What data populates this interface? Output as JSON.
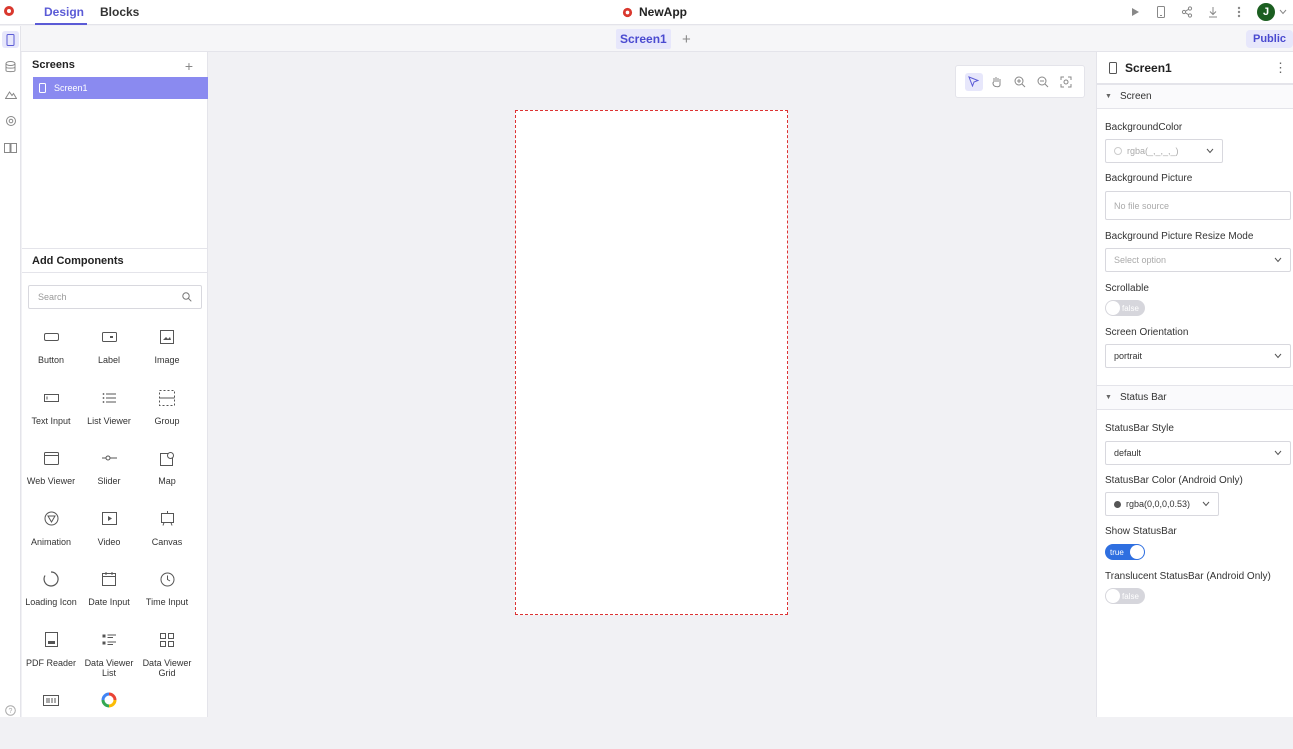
{
  "topbar": {
    "tabs": [
      "Design",
      "Blocks"
    ],
    "app_name": "NewApp",
    "avatar_initial": "J",
    "icons": [
      "play-icon",
      "device-icon",
      "share-icon",
      "download-icon",
      "more-vertical-icon",
      "chevron-down-icon"
    ]
  },
  "rail": {
    "items": [
      "phone-icon",
      "database-icon",
      "image-icon",
      "gear-icon",
      "book-icon",
      "help-icon"
    ]
  },
  "screenbar": {
    "active_screen": "Screen1",
    "add_symbol": "+",
    "public_label": "Public"
  },
  "screens_panel": {
    "title": "Screens",
    "add_symbol": "+",
    "items": [
      "Screen1"
    ]
  },
  "components_panel": {
    "title": "Add Components",
    "search_placeholder": "Search",
    "components": [
      {
        "label": "Button",
        "icon": "button-icon"
      },
      {
        "label": "Label",
        "icon": "label-icon"
      },
      {
        "label": "Image",
        "icon": "image-icon"
      },
      {
        "label": "Text Input",
        "icon": "text-input-icon"
      },
      {
        "label": "List Viewer",
        "icon": "list-icon"
      },
      {
        "label": "Group",
        "icon": "group-icon"
      },
      {
        "label": "Web Viewer",
        "icon": "web-viewer-icon"
      },
      {
        "label": "Slider",
        "icon": "slider-icon"
      },
      {
        "label": "Map",
        "icon": "map-icon"
      },
      {
        "label": "Animation",
        "icon": "animation-icon"
      },
      {
        "label": "Video",
        "icon": "video-icon"
      },
      {
        "label": "Canvas",
        "icon": "canvas-icon"
      },
      {
        "label": "Loading Icon",
        "icon": "loading-icon"
      },
      {
        "label": "Date Input",
        "icon": "calendar-icon"
      },
      {
        "label": "Time Input",
        "icon": "clock-icon"
      },
      {
        "label": "PDF Reader",
        "icon": "pdf-icon"
      },
      {
        "label": "Data Viewer List",
        "icon": "data-list-icon"
      },
      {
        "label": "Data Viewer Grid",
        "icon": "data-grid-icon"
      },
      {
        "label": "",
        "icon": "barcode-icon"
      },
      {
        "label": "",
        "icon": "google-icon"
      }
    ]
  },
  "canvas": {
    "tools": [
      "pointer-icon",
      "hand-icon",
      "zoom-in-icon",
      "zoom-out-icon",
      "fit-screen-icon"
    ]
  },
  "properties": {
    "title": "Screen1",
    "screen_section": "Screen",
    "background_color_label": "BackgroundColor",
    "background_color_value": "rgba(_,_,_,_)",
    "background_picture_label": "Background Picture",
    "background_picture_value": "No file source",
    "resize_mode_label": "Background Picture Resize Mode",
    "resize_mode_placeholder": "Select option",
    "scrollable_label": "Scrollable",
    "scrollable_value": "false",
    "orientation_label": "Screen Orientation",
    "orientation_value": "portrait",
    "status_section": "Status Bar",
    "statusbar_style_label": "StatusBar Style",
    "statusbar_style_value": "default",
    "statusbar_color_label": "StatusBar Color (Android Only)",
    "statusbar_color_value": "rgba(0,0,0,0.53)",
    "show_statusbar_label": "Show StatusBar",
    "show_statusbar_value": "true",
    "translucent_label": "Translucent StatusBar (Android Only)",
    "translucent_value": "false"
  },
  "colors": {
    "accent": "#5b5bd6",
    "selected_screen": "#8a8af0",
    "toggle_on": "#2f6fe0",
    "phone_border": "#dd3333"
  }
}
